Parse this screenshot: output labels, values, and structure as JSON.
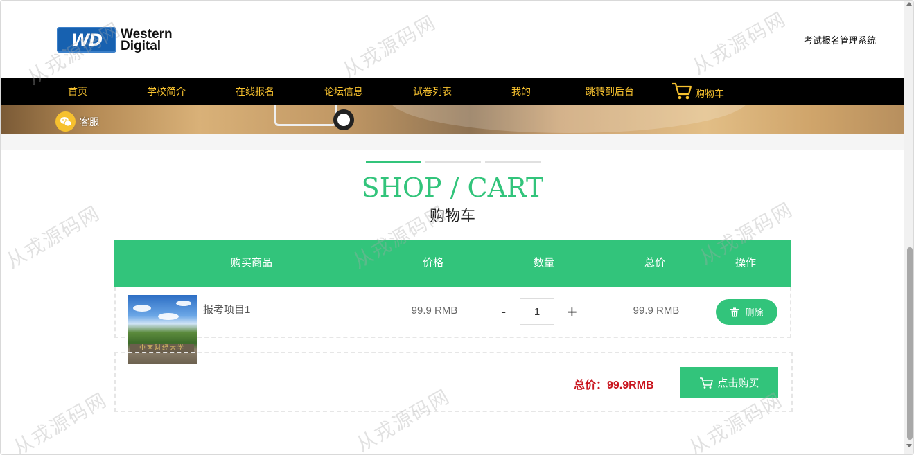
{
  "header": {
    "logo_text_line1": "Western",
    "logo_text_line2": "Digital",
    "logo_badge": "WD",
    "system_title": "考试报名管理系统"
  },
  "nav": {
    "items": [
      {
        "label": "首页"
      },
      {
        "label": "学校简介"
      },
      {
        "label": "在线报名"
      },
      {
        "label": "论坛信息"
      },
      {
        "label": "试卷列表"
      },
      {
        "label": "我的"
      },
      {
        "label": "跳转到后台"
      }
    ],
    "cart_label": "购物车"
  },
  "kefu": {
    "label": "客服"
  },
  "section": {
    "title_en": "SHOP / CART",
    "title_cn": "购物车"
  },
  "table": {
    "headers": [
      "购买商品",
      "价格",
      "数量",
      "总价",
      "操作"
    ],
    "rows": [
      {
        "name": "报考项目1",
        "price": "99.9 RMB",
        "quantity": "1",
        "minus": "-",
        "plus": "+",
        "total": "99.9 RMB",
        "delete_label": "删除",
        "image_caption": "中南财经大学"
      }
    ]
  },
  "summary": {
    "total_text": "总价：99.9RMB",
    "buy_label": "点击购买"
  },
  "watermark": "从戎源码网",
  "colors": {
    "accent": "#32c47b",
    "nav_text": "#f6c12f",
    "total_price": "#c9151e"
  }
}
